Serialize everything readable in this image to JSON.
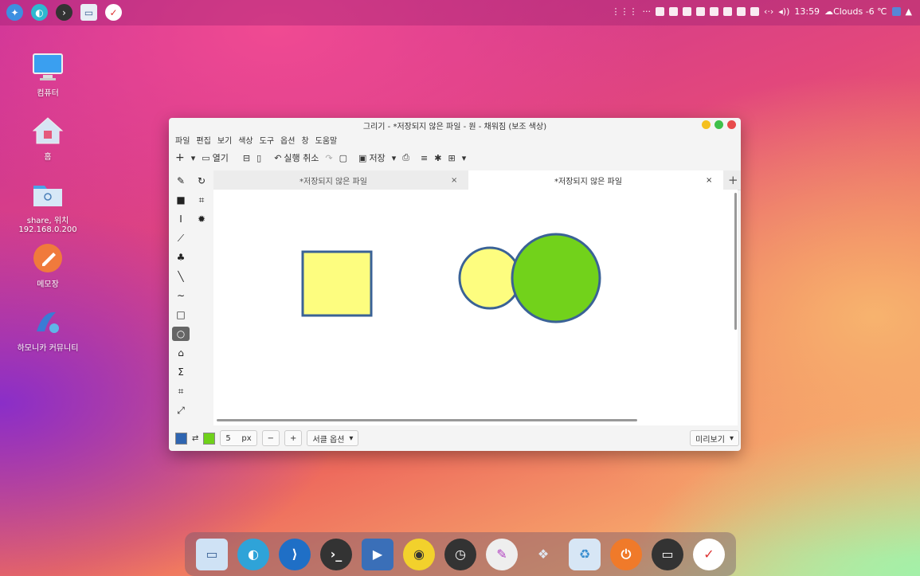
{
  "topbar": {
    "clock": "13:59",
    "weather": "Clouds -6 ℃"
  },
  "desktop": [
    {
      "label": "컴퓨터",
      "icon": "computer-icon"
    },
    {
      "label": "홈",
      "icon": "home-folder-icon"
    },
    {
      "label": "share, 위치\n192.168.0.200",
      "label1": "share, 위치",
      "label2": "192.168.0.200",
      "icon": "network-share-icon"
    },
    {
      "label": "메모장",
      "icon": "notepad-icon"
    },
    {
      "label": "하모니카 커뮤니티",
      "icon": "community-icon"
    }
  ],
  "window": {
    "title": "그리기 - *저장되지 않은 파일 - 원 - 채워짐 (보조 색상)",
    "menu": [
      "파일",
      "편집",
      "보기",
      "색상",
      "도구",
      "옵션",
      "창",
      "도움말"
    ],
    "toolbar": {
      "new": "+",
      "open": "열기",
      "undo": "실행 취소",
      "save": "저장"
    },
    "tabs": [
      {
        "label": "*저장되지 않은 파일",
        "close": "×"
      },
      {
        "label": "*저장되지 않은 파일",
        "close": "×"
      }
    ],
    "new_tab": "+",
    "status": {
      "size": "5",
      "unit": "px",
      "minus": "−",
      "plus": "+",
      "font_options": "서클 옵션",
      "preview": "미리보기"
    },
    "colors": {
      "primary": "#2f65b0",
      "secondary": "#6fd11a"
    }
  },
  "canvas_shapes": {
    "square_fill": "#fdfd7f",
    "square_stroke": "#3a6296",
    "circle_small_fill": "#fdfd7f",
    "circle_big_fill": "#72d21b",
    "stroke": "#3a6296"
  },
  "dock": [
    "files-icon",
    "browser-icon",
    "vscode-icon",
    "terminal-icon",
    "screen-record-icon",
    "media-player-icon",
    "speed-icon",
    "drawing-icon",
    "apps-icon",
    "trash-icon",
    "power-icon",
    "remote-icon",
    "drawing-app-icon"
  ]
}
